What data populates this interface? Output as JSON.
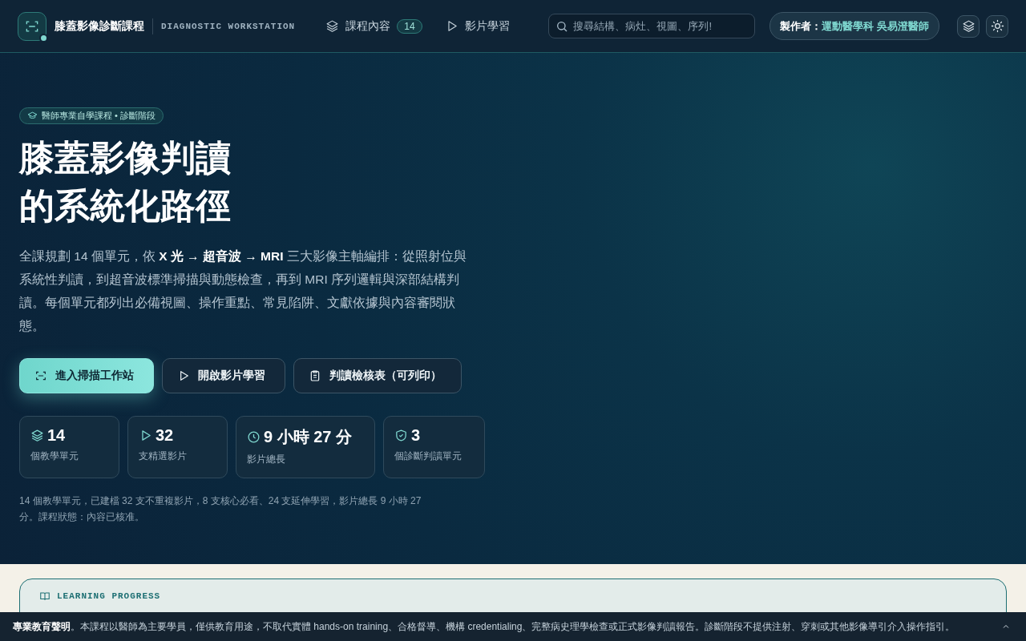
{
  "header": {
    "brand_title": "膝蓋影像診斷課程",
    "brand_subtitle": "DIAGNOSTIC WORKSTATION",
    "online": true,
    "nav": [
      {
        "kind": "layers",
        "label": "課程內容",
        "badge": "14"
      },
      {
        "kind": "play",
        "label": "影片學習"
      }
    ],
    "search": {
      "placeholder": "搜尋結構、病灶、視圖、序列!"
    },
    "author": {
      "label": "製作者：",
      "name": "運動醫學科 吳易澄醫師"
    }
  },
  "hero": {
    "tag": "醫師專業自學課程 • 診斷階段",
    "title_lines": [
      "膝蓋影像判讀",
      "的系統化路徑"
    ],
    "intro": "全課規劃 14 個單元，依 **X 光 → 超音波 → MRI** 三大影像主軸編排：從照射位與系統性判讀，到超音波標準掃描與動態檢查，再到 MRI 序列邏輯與深部結構判讀。每個單元都列出必備視圖、操作重點、常見陷阱、文獻依據與內容審閱狀態。",
    "buttons": [
      {
        "kind": "scan",
        "label": "進入掃描工作站",
        "primary": true
      },
      {
        "kind": "play",
        "label": "開啟影片學習",
        "primary": false
      },
      {
        "kind": "clipboard",
        "label": "判讀檢核表（可列印）",
        "primary": false
      }
    ],
    "stats": [
      {
        "kind": "layers",
        "value": "14",
        "label": "個教學單元"
      },
      {
        "kind": "play",
        "value": "32",
        "label": "支精選影片"
      },
      {
        "kind": "clock",
        "value": "9 小時 27 分",
        "label": "影片總長"
      },
      {
        "kind": "shield",
        "value": "3",
        "label": "個診斷判讀單元"
      }
    ],
    "summary": "14 個教學單元，已建檔 32 支不重複影片，8 支核心必看、24 支延伸學習，影片總長 9 小時 27 分。課程狀態：內容已核准。"
  },
  "progress": {
    "heading": "LEARNING PROGRESS"
  },
  "disclaimer": {
    "text": "**專業教育聲明**。本課程以醫師為主要學員，僅供教育用途，不取代實體 hands-on training、合格督導、機構 credentialing、完整病史理學檢查或正式影像判讀報告。診斷階段不提供注射、穿刺或其他影像導引介入操作指引。",
    "collapsed": false
  }
}
